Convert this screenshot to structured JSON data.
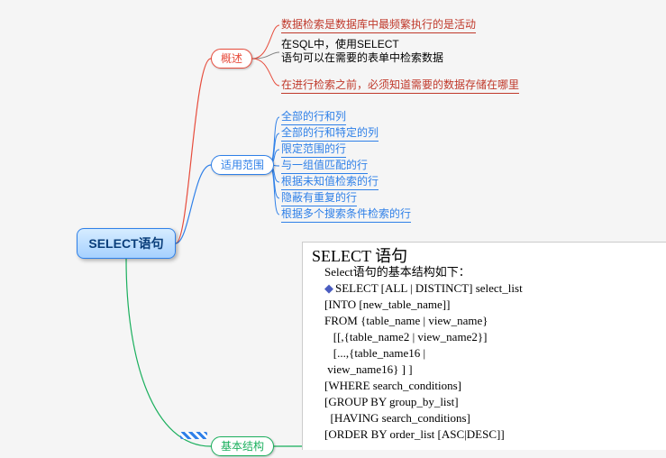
{
  "root": {
    "label": "SELECT语句"
  },
  "branches": {
    "overview": {
      "label": "概述",
      "items": [
        "数据检索是数据库中最频繁执行的是活动",
        "在SQL中，使用SELECT 语句可以在需要的表单中检索数据",
        "在进行检索之前，必须知道需要的数据存储在哪里"
      ]
    },
    "scope": {
      "label": "适用范围",
      "items": [
        "全部的行和列",
        "全部的行和特定的列",
        "限定范围的行",
        "与一组值匹配的行",
        "根据未知值检索的行",
        "隐蔽有重复的行",
        "根据多个搜索条件检索的行"
      ]
    },
    "structure": {
      "label": "基本结构",
      "code": {
        "title": "SELECT 语句",
        "subtitle": "Select语句的基本结构如下：",
        "lines": [
          "SELECT [ALL | DISTINCT] select_list",
          "[INTO [new_table_name]]",
          "FROM {table_name | view_name}",
          "   [[,{table_name2 | view_name2}]",
          "   [...,{table_name16 |",
          " view_name16} ] ]",
          "[WHERE search_conditions]",
          "[GROUP BY group_by_list]",
          "  [HAVING search_conditions]",
          "[ORDER BY order_list [ASC|DESC]]"
        ]
      }
    }
  },
  "chart_data": {
    "type": "diagram",
    "root": "SELECT语句",
    "children": [
      {
        "label": "概述",
        "color": "red",
        "children": [
          "数据检索是数据库中最频繁执行的是活动",
          "在SQL中，使用SELECT 语句可以在需要的表单中检索数据",
          "在进行检索之前，必须知道需要的数据存储在哪里"
        ]
      },
      {
        "label": "适用范围",
        "color": "blue",
        "children": [
          "全部的行和列",
          "全部的行和特定的列",
          "限定范围的行",
          "与一组值匹配的行",
          "根据未知值检索的行",
          "隐蔽有重复的行",
          "根据多个搜索条件检索的行"
        ]
      },
      {
        "label": "基本结构",
        "color": "green",
        "children": [
          "SELECT 语句 基本语法结构代码块"
        ]
      }
    ]
  }
}
